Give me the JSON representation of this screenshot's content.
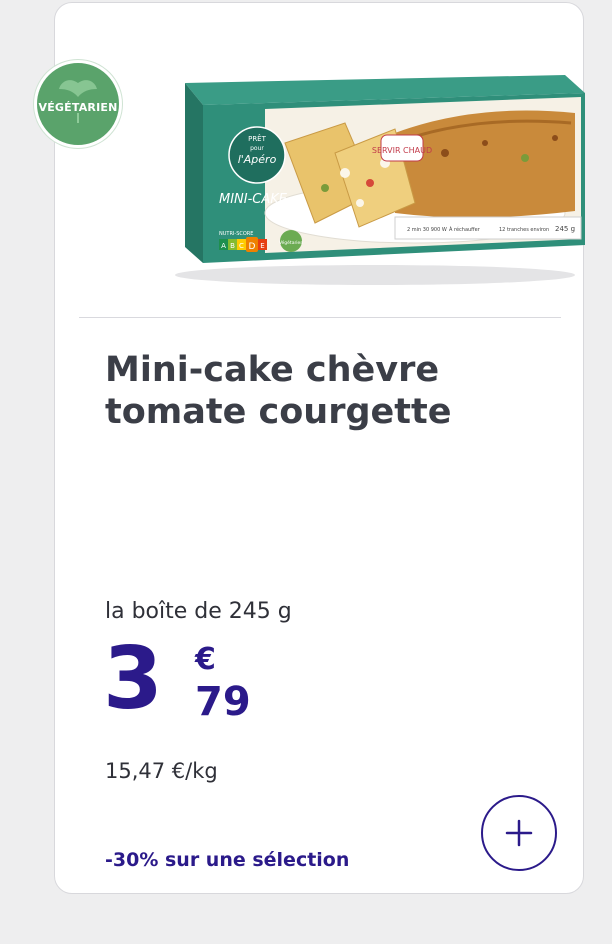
{
  "badge": {
    "label": "VÉGÉTARIEN",
    "color": "#5aa36b",
    "icon": "leaf-icon"
  },
  "package": {
    "brand_line_1": "PRÊT",
    "brand_line_2": "pour",
    "brand_line_3": "l'Apéro",
    "product_name": "MINI-CAKE",
    "serve_hint": "SERVIR CHAUD",
    "info_1": "2 min 30 900 W",
    "info_2": "À réchauffer",
    "info_3": "12 tranches environ",
    "weight": "245 g",
    "nutri_score_label": "NUTRI-SCORE",
    "nutri_grades": [
      "A",
      "B",
      "C",
      "D",
      "E"
    ],
    "nutri_active": "D",
    "veg_mark": "Végétarien"
  },
  "product": {
    "title": "Mini-cake chèvre tomate courgette",
    "unit_label": "la boîte de 245 g",
    "price_int": "3",
    "price_currency": "€",
    "price_cents": "79",
    "price_per_kg": "15,47 €/kg",
    "promo": "-30% sur une sélection"
  },
  "actions": {
    "add_icon": "plus-icon"
  },
  "colors": {
    "brand_blue": "#2b1a8a",
    "title_gray": "#3b3e47",
    "package_green": "#2f8f7a"
  }
}
